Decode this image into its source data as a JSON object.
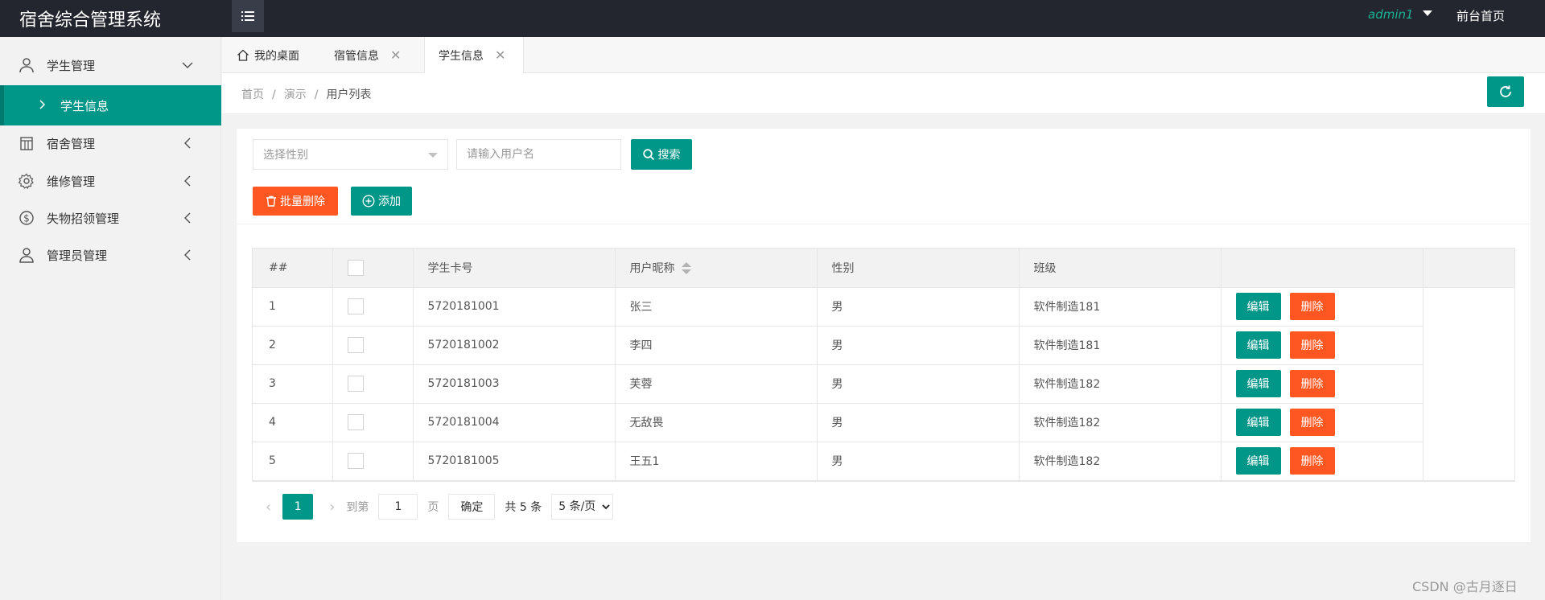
{
  "header": {
    "title": "宿舍综合管理系统",
    "user": "admin1",
    "front_link": "前台首页"
  },
  "sidebar": {
    "items": [
      {
        "label": "学生管理",
        "icon": "user-icon",
        "expanded": true
      },
      {
        "label": "宿舍管理",
        "icon": "building-icon"
      },
      {
        "label": "维修管理",
        "icon": "gear-icon"
      },
      {
        "label": "失物招领管理",
        "icon": "dollar-circle-icon"
      },
      {
        "label": "管理员管理",
        "icon": "admin-user-icon"
      }
    ],
    "sub_item": {
      "label": "学生信息"
    }
  },
  "tabs": [
    {
      "label": "我的桌面",
      "icon": "home-icon"
    },
    {
      "label": "宿管信息",
      "closable": true
    },
    {
      "label": "学生信息",
      "closable": true,
      "active": true
    }
  ],
  "breadcrumb": [
    "首页",
    "演示",
    "用户列表"
  ],
  "filters": {
    "gender_placeholder": "选择性别",
    "username_placeholder": "请输入用户名",
    "search_label": "搜索"
  },
  "actions": {
    "batch_delete": "批量删除",
    "add": "添加"
  },
  "table": {
    "headers": [
      "##",
      "",
      "学生卡号",
      "用户昵称",
      "性别",
      "班级",
      "",
      ""
    ],
    "rows": [
      {
        "no": "1",
        "card": "5720181001",
        "nick": "张三",
        "gender": "男",
        "class": "软件制造181"
      },
      {
        "no": "2",
        "card": "5720181002",
        "nick": "李四",
        "gender": "男",
        "class": "软件制造181"
      },
      {
        "no": "3",
        "card": "5720181003",
        "nick": "芙蓉",
        "gender": "男",
        "class": "软件制造182"
      },
      {
        "no": "4",
        "card": "5720181004",
        "nick": "无敌畏",
        "gender": "男",
        "class": "软件制造182"
      },
      {
        "no": "5",
        "card": "5720181005",
        "nick": "王五1",
        "gender": "男",
        "class": "软件制造182"
      }
    ],
    "edit_label": "编辑",
    "delete_label": "删除"
  },
  "pager": {
    "current": "1",
    "goto_label": "到第",
    "page_input": "1",
    "page_label": "页",
    "ok_label": "确定",
    "total": "共 5 条",
    "size_option": "5 条/页"
  },
  "watermark": "CSDN @古月逐日",
  "colors": {
    "primary": "#009688",
    "danger": "#ff5722",
    "header_bg": "#23262e"
  }
}
